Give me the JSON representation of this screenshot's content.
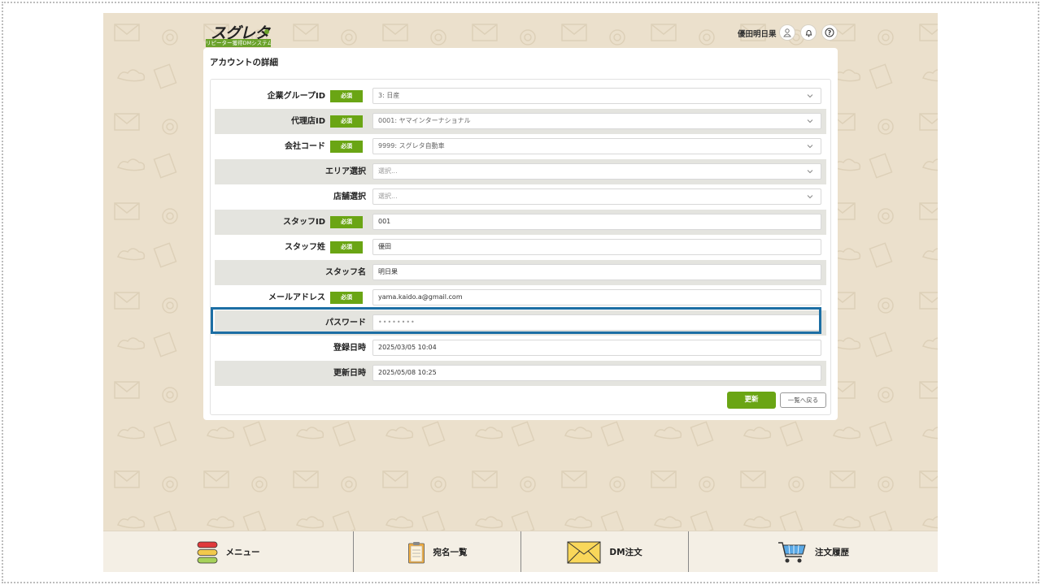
{
  "header": {
    "logo_text": "スグレタ",
    "logo_subtitle": "リピーター獲得DMシステム",
    "user_name": "優田明日果",
    "icons": [
      "user-icon",
      "bell-icon",
      "help-icon"
    ]
  },
  "page": {
    "title": "アカウントの詳細"
  },
  "required_badge": "必須",
  "form": {
    "rows": [
      {
        "label": "企業グループID",
        "required": true,
        "type": "select",
        "value": "3: 日産"
      },
      {
        "label": "代理店ID",
        "required": true,
        "type": "select",
        "value": "0001: ヤマインターナショナル"
      },
      {
        "label": "会社コード",
        "required": true,
        "type": "select",
        "value": "9999: スグレタ自動車"
      },
      {
        "label": "エリア選択",
        "required": false,
        "type": "select",
        "value": "選択..."
      },
      {
        "label": "店舗選択",
        "required": false,
        "type": "select",
        "value": "選択..."
      },
      {
        "label": "スタッフID",
        "required": true,
        "type": "text",
        "value": "001"
      },
      {
        "label": "スタッフ姓",
        "required": true,
        "type": "text",
        "value": "優田"
      },
      {
        "label": "スタッフ名",
        "required": false,
        "type": "text",
        "value": "明日果"
      },
      {
        "label": "メールアドレス",
        "required": true,
        "type": "text",
        "value": "yama.kaido.a@gmail.com"
      },
      {
        "label": "パスワード",
        "required": false,
        "type": "password",
        "value": "••••••••"
      },
      {
        "label": "登録日時",
        "required": false,
        "type": "text",
        "value": "2025/03/05 10:04"
      },
      {
        "label": "更新日時",
        "required": false,
        "type": "text",
        "value": "2025/05/08 10:25"
      }
    ]
  },
  "actions": {
    "update_label": "更新",
    "back_label": "一覧へ戻る"
  },
  "bottom_nav": [
    {
      "label": "メニュー",
      "icon": "menu-icon"
    },
    {
      "label": "宛名一覧",
      "icon": "clipboard-icon"
    },
    {
      "label": "DM注文",
      "icon": "envelope-icon"
    },
    {
      "label": "注文履歴",
      "icon": "cart-icon"
    }
  ],
  "colors": {
    "background": "#ebe0cc",
    "accent_green": "#6aa514",
    "highlight_blue": "#1c6ea4"
  }
}
